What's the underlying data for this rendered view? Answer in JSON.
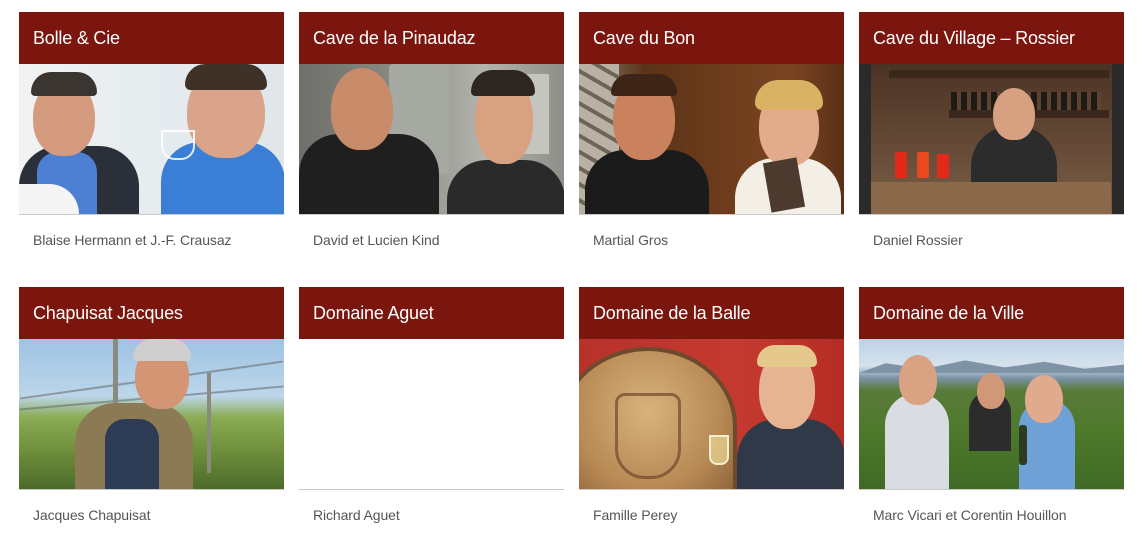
{
  "producers": [
    {
      "title": "Bolle & Cie",
      "caption": "Blaise Hermann et J.-F. Crausaz",
      "photo": "two-men-tasting-wine-photo"
    },
    {
      "title": "Cave de la Pinaudaz",
      "caption": "David et Lucien Kind",
      "photo": "two-men-in-winery-photo"
    },
    {
      "title": "Cave du Bon",
      "caption": "Martial Gros",
      "photo": "man-and-woman-in-cellar-photo"
    },
    {
      "title": "Cave du Village – Rossier",
      "caption": "Daniel Rossier",
      "photo": "man-at-bar-counter-photo"
    },
    {
      "title": "Chapuisat Jacques",
      "caption": "Jacques Chapuisat",
      "photo": "man-in-vineyard-photo"
    },
    {
      "title": "Domaine Aguet",
      "caption": "Richard Aguet",
      "photo": ""
    },
    {
      "title": "Domaine de la Balle",
      "caption": "Famille Perey",
      "photo": "man-with-wine-barrel-photo"
    },
    {
      "title": "Domaine de la Ville",
      "caption": "Marc Vicari et Corentin Houillon",
      "photo": "three-men-in-vineyard-photo"
    }
  ],
  "colors": {
    "header_bg": "#7a160d",
    "header_text": "#ffffff",
    "caption_text": "#555555"
  }
}
